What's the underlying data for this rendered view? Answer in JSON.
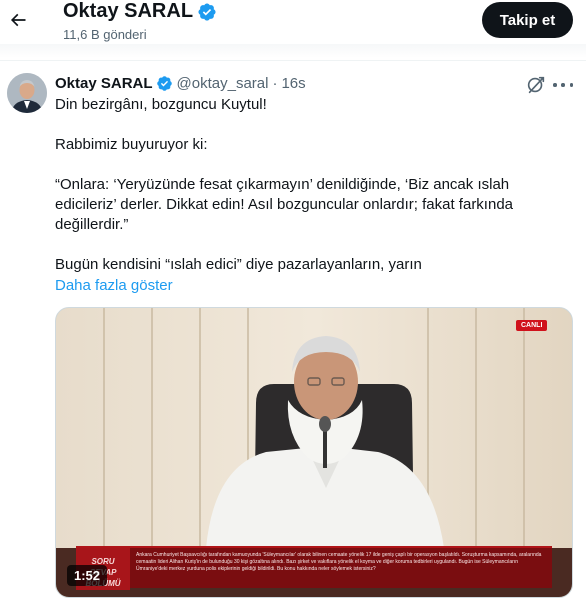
{
  "header": {
    "name": "Oktay SARAL",
    "post_count": "11,6 B gönderi",
    "follow_label": "Takip et"
  },
  "tweet": {
    "author_name": "Oktay SARAL",
    "handle": "@oktay_saral",
    "separator": "·",
    "time": "16s",
    "lines": [
      "Din bezirgânı, bozguncu Kuytul!",
      "",
      "Rabbimiz buyuruyor ki:",
      "",
      "“Onlara: ‘Yeryüzünde fesat çıkarmayın’ denildiğinde, ‘Biz ancak ıslah",
      "edicileriz’ derler. Dikkat edin! Asıl bozguncular onlardır; fakat farkında",
      "değillerdir.”",
      "",
      "Bugün kendisini “ıslah edici” diye pazarlayanların, yarın"
    ],
    "show_more": "Daha fazla göster"
  },
  "media": {
    "duration": "1:52",
    "live_badge": "CANLI",
    "banner_tag_line1": "SORU CEVAP",
    "banner_tag_line2": "BÖLÜMÜ",
    "banner_text": "Ankara Cumhuriyet Başsavcılığı tarafından kamuoyunda 'Süleymancılar' olarak bilinen cemaate yönelik 17 ilde geniş çaplı bir operasyon başlatıldı. Soruşturma kapsamında, aralarında cemaatin lideri Alihan Kuriş'in de bulunduğu 30 kişi gözaltına alındı. Bazı şirket ve vakıflara yönelik el koyma ve diğer koruma tedbirleri uygulandı. Bugün ise Süleymancıların Ümraniye'deki merkez yurduna polis ekiplerinin geldiği bildirildi. Bu konu hakkında neler söylemek istersiniz?"
  },
  "colors": {
    "accent": "#1d9bf0",
    "verified": "#1d9bf0",
    "text": "#0f1419",
    "muted": "#536471",
    "follow_bg": "#0f1419",
    "banner": "#7a0d10"
  },
  "icons": {
    "back": "arrow-left-icon",
    "verified": "verified-badge-icon",
    "grok": "grok-icon",
    "more": "more-icon",
    "play": "video-duration"
  }
}
